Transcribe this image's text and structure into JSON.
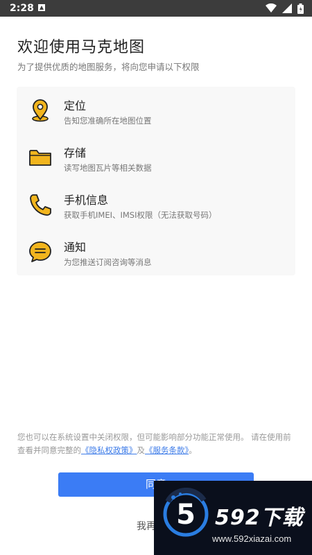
{
  "status_bar": {
    "time": "2:28"
  },
  "header": {
    "title": "欢迎使用马克地图",
    "subtitle": "为了提供优质的地图服务，将向您申请以下权限"
  },
  "permissions": [
    {
      "icon": "location-pin-icon",
      "title": "定位",
      "desc": "告知您准确所在地图位置"
    },
    {
      "icon": "folder-icon",
      "title": "存储",
      "desc": "读写地图瓦片等相关数据"
    },
    {
      "icon": "phone-icon",
      "title": "手机信息",
      "desc": "获取手机IMEI、IMSI权限（无法获取号码）"
    },
    {
      "icon": "chat-bubble-icon",
      "title": "通知",
      "desc": "为您推送订阅咨询等消息"
    }
  ],
  "notice": {
    "text": "您也可以在系统设置中关闭权限，但可能影响部分功能正常使用。 请在使用前查看并同意完整的",
    "privacy_link": "《隐私权政策》",
    "joiner": "及",
    "terms_link": "《服务条款》",
    "end": "。"
  },
  "actions": {
    "agree": "同意",
    "later": "我再想想"
  },
  "watermark": {
    "brand": "592下载",
    "url": "www.592xiazai.com"
  },
  "colors": {
    "accent": "#3b7cf5",
    "icon": "#f2b51e",
    "link": "#3b7ae8"
  }
}
